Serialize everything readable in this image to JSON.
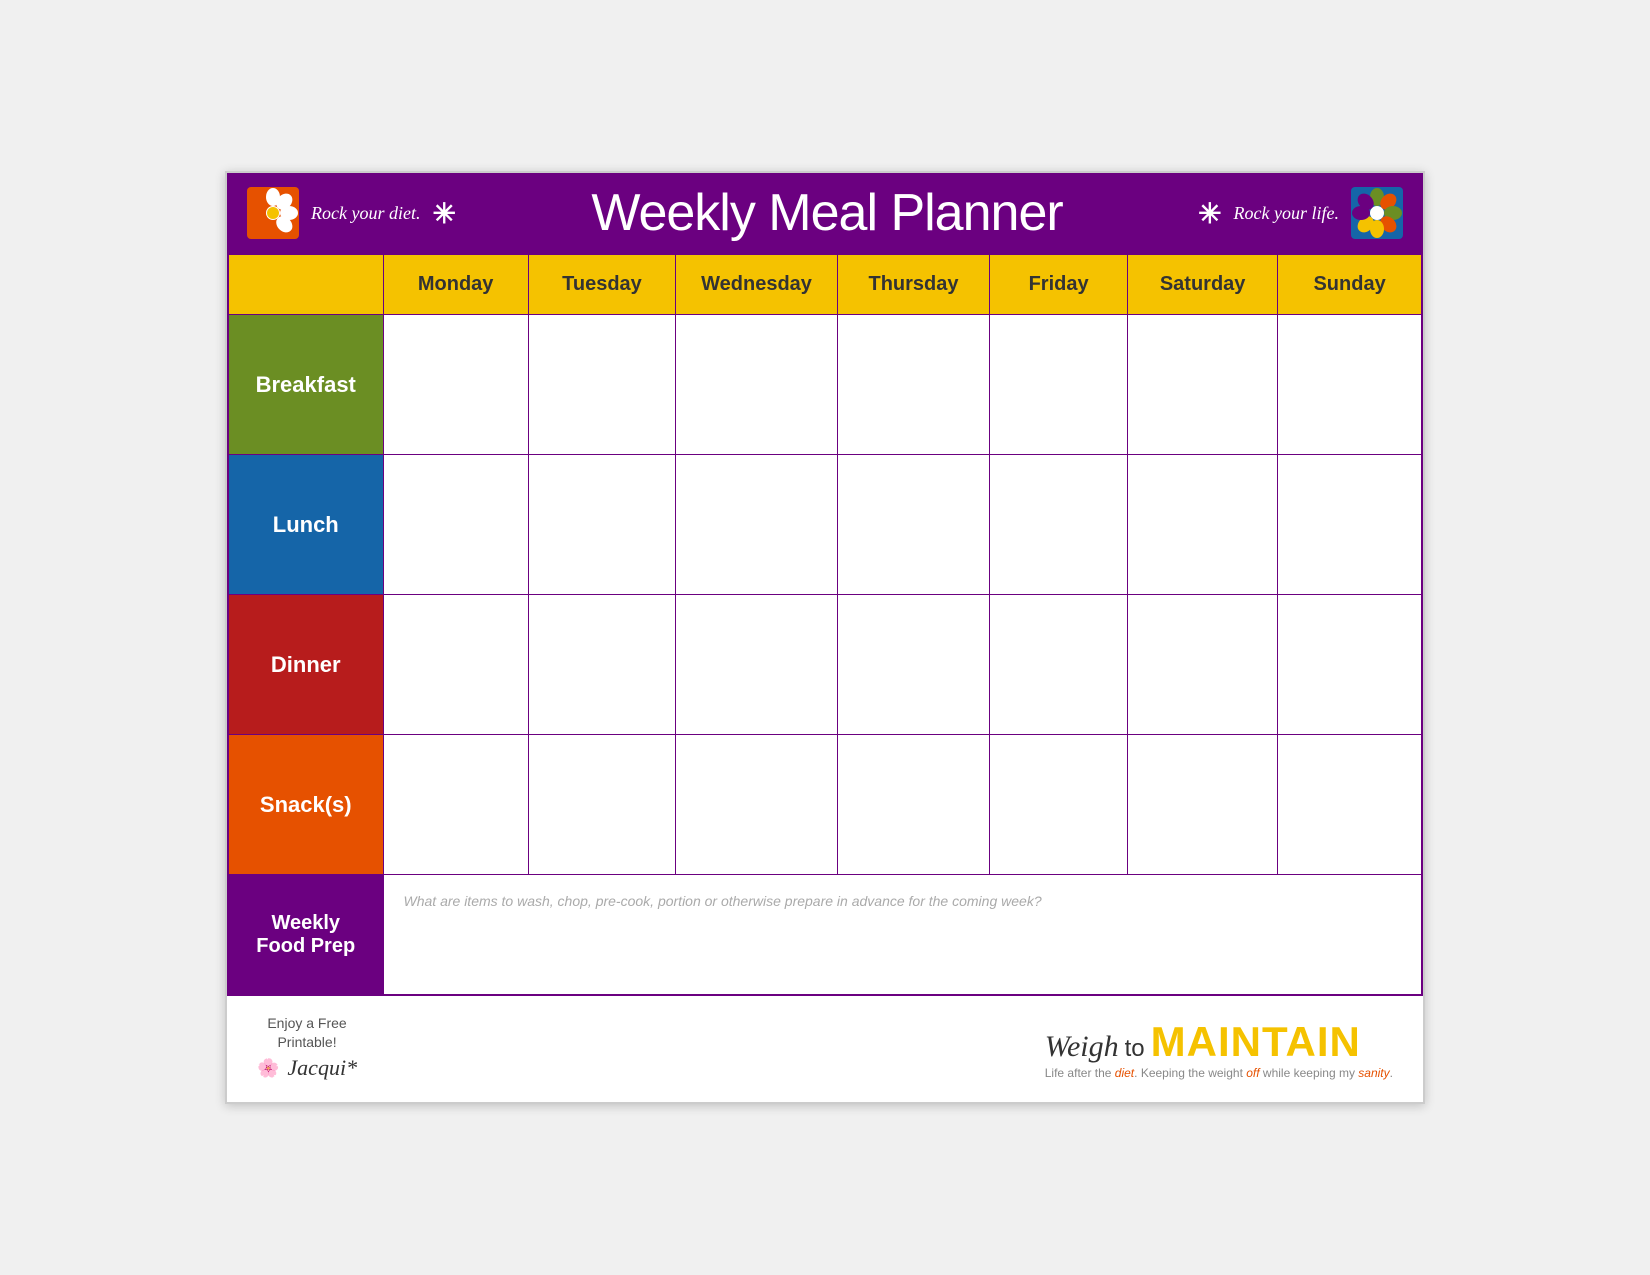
{
  "header": {
    "tagline_left": "Rock your diet.",
    "title": "Weekly Meal Planner",
    "tagline_right": "Rock your life.",
    "asterisk": "✳"
  },
  "days": [
    "Monday",
    "Tuesday",
    "Wednesday",
    "Thursday",
    "Friday",
    "Saturday",
    "Sunday"
  ],
  "rows": [
    {
      "label": "Breakfast",
      "color_class": "breakfast-label"
    },
    {
      "label": "Lunch",
      "color_class": "lunch-label"
    },
    {
      "label": "Dinner",
      "color_class": "dinner-label"
    },
    {
      "label": "Snack(s)",
      "color_class": "snacks-label"
    }
  ],
  "weekly_prep": {
    "label": "Weekly\nFood Prep",
    "placeholder": "What are items to wash, chop, pre-cook, portion or otherwise prepare in advance for the coming week?"
  },
  "footer": {
    "enjoy_text": "Enjoy a Free",
    "printable_text": "Printable!",
    "author": "Jacqui*",
    "brand_weigh": "Weigh",
    "brand_to": "to",
    "brand_maintain": "MAINTAIN",
    "tagline": "Life after the diet. Keeping the weight off while keeping my sanity."
  }
}
